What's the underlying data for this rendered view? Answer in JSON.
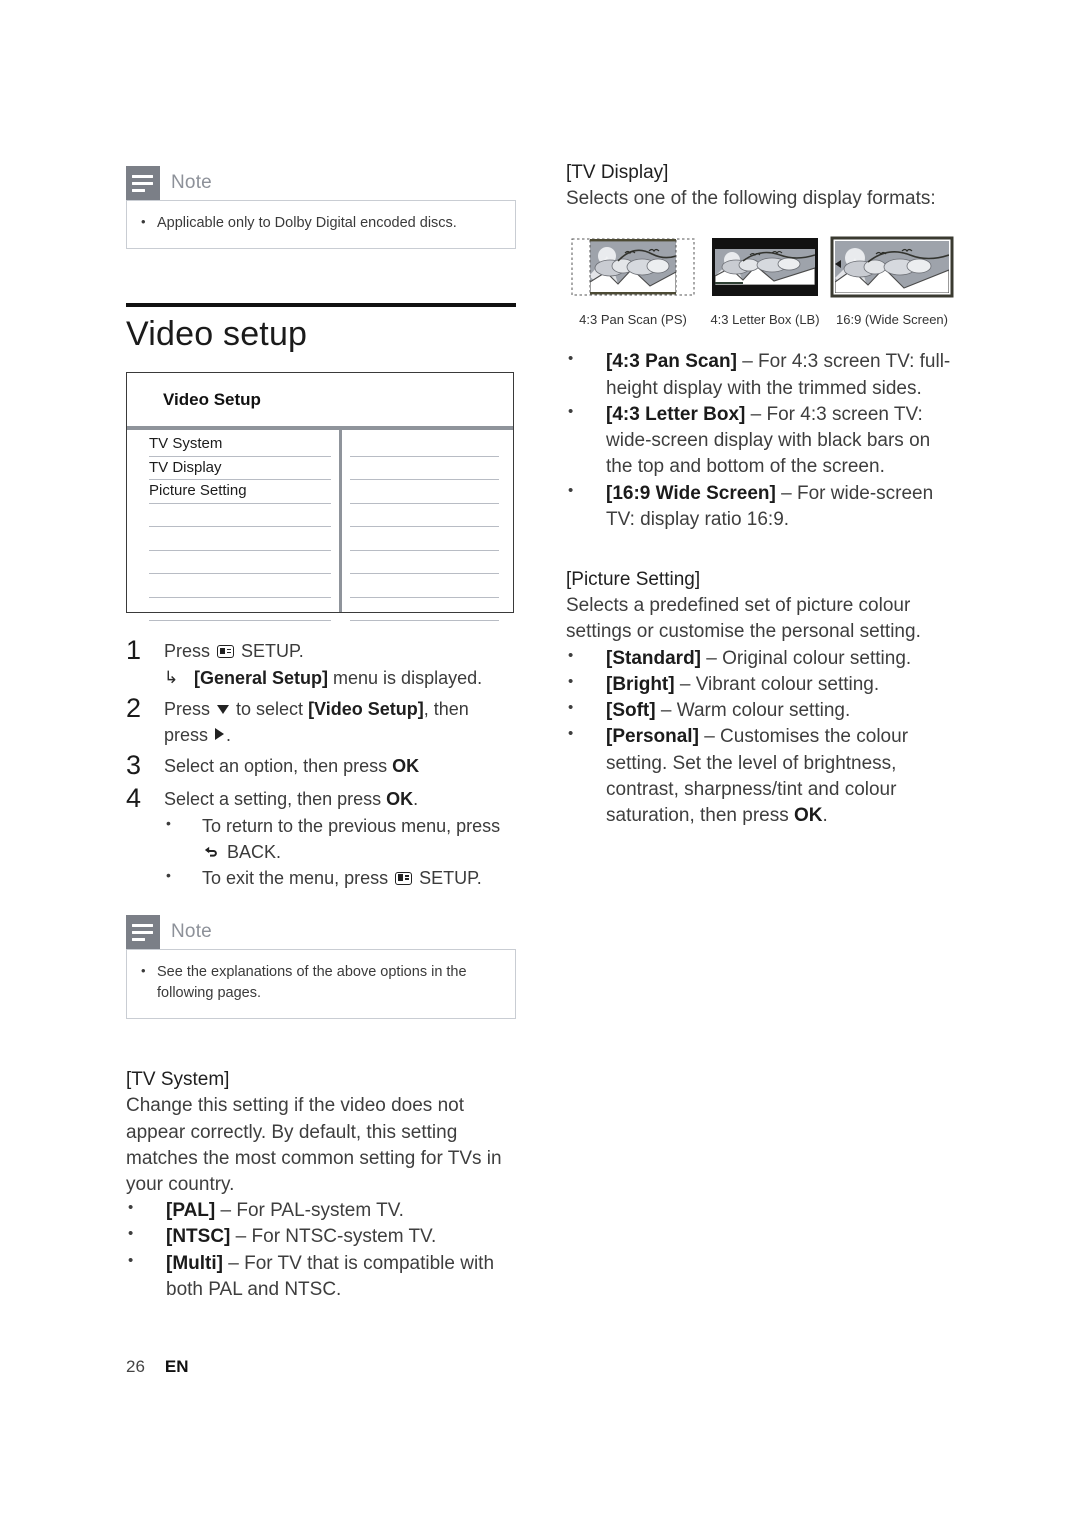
{
  "note_top": {
    "title": "Note",
    "items": [
      "Applicable only to Dolby Digital encoded discs."
    ]
  },
  "section": {
    "heading": "Video setup"
  },
  "panel": {
    "title": "Video Setup",
    "rows": [
      "TV System",
      "TV Display",
      "Picture Setting",
      "",
      "",
      "",
      "",
      ""
    ],
    "values": [
      "",
      "",
      "",
      "",
      "",
      "",
      "",
      ""
    ]
  },
  "steps": [
    {
      "num": "1",
      "pre": "Press ",
      "icon": "setup-icon",
      "post": " SETUP.",
      "arrow_pre": "",
      "arrow_bold": "[General Setup]",
      "arrow_post": " menu is displayed."
    },
    {
      "num": "2",
      "pre": "Press ",
      "icon": "triangle-down-icon",
      "mid": " to select ",
      "bold": "[Video Setup]",
      "post": ", then press ",
      "icon2": "triangle-right-icon",
      "tail": "."
    },
    {
      "num": "3",
      "text": "Select an option, then press ",
      "bold_tail": "OK"
    },
    {
      "num": "4",
      "text": "Select a setting, then press ",
      "bold_tail": "OK",
      "tail": ".",
      "bullets": [
        {
          "pre": "To return to the previous menu, press ",
          "icon": "back-icon",
          "post": " BACK."
        },
        {
          "pre": "To exit the menu, press ",
          "icon": "setup-icon",
          "post": " SETUP."
        }
      ]
    }
  ],
  "note_bottom": {
    "title": "Note",
    "items": [
      "See the explanations of the above options in the following pages."
    ]
  },
  "tv_system": {
    "heading": "[TV System]",
    "paragraph": "Change this setting if the video does not appear correctly. By default, this setting matches the most common setting for TVs in your country.",
    "bullets": [
      {
        "term": "[PAL]",
        "desc": " – For PAL-system TV."
      },
      {
        "term": "[NTSC]",
        "desc": " – For NTSC-system TV."
      },
      {
        "term": "[Multi]",
        "desc": " – For TV that is compatible with both PAL and NTSC."
      }
    ]
  },
  "tv_display": {
    "heading": "[TV Display]",
    "paragraph": "Selects one of the following display formats:",
    "figures": [
      {
        "caption": "4:3 Pan Scan (PS)",
        "kind": "pan-scan"
      },
      {
        "caption": "4:3 Letter Box (LB)",
        "kind": "letter-box"
      },
      {
        "caption": "16:9 (Wide Screen)",
        "kind": "wide-screen"
      }
    ],
    "bullets": [
      {
        "term": "[4:3 Pan Scan]",
        "desc": " – For 4:3 screen TV: full-height display with the trimmed sides."
      },
      {
        "term": "[4:3 Letter Box]",
        "desc": " – For 4:3 screen TV: wide-screen display with black bars on the top and bottom of the screen."
      },
      {
        "term": "[16:9 Wide Screen]",
        "desc": " – For wide-screen TV: display ratio 16:9."
      }
    ]
  },
  "picture_setting": {
    "heading": "[Picture Setting]",
    "paragraph": "Selects a predefined set of picture colour settings or customise the personal setting.",
    "bullets": [
      {
        "term": "[Standard]",
        "desc": " – Original colour setting."
      },
      {
        "term": "[Bright]",
        "desc": " – Vibrant colour setting."
      },
      {
        "term": "[Soft]",
        "desc": " – Warm colour setting."
      },
      {
        "term": "[Personal]",
        "desc": " – Customises the colour setting. Set the level of brightness, contrast, sharpness/tint and colour saturation, then press ",
        "bold_tail": "OK",
        "tail": "."
      }
    ]
  },
  "footer": {
    "page": "26",
    "language": "EN"
  },
  "colors": {
    "note_icon_bg": "#7b7f87",
    "note_title": "#8d9199",
    "note_border": "#c9cdd3",
    "rule": "#111111",
    "panel_divider": "#8f949b",
    "sky": "#9ea3ab"
  }
}
